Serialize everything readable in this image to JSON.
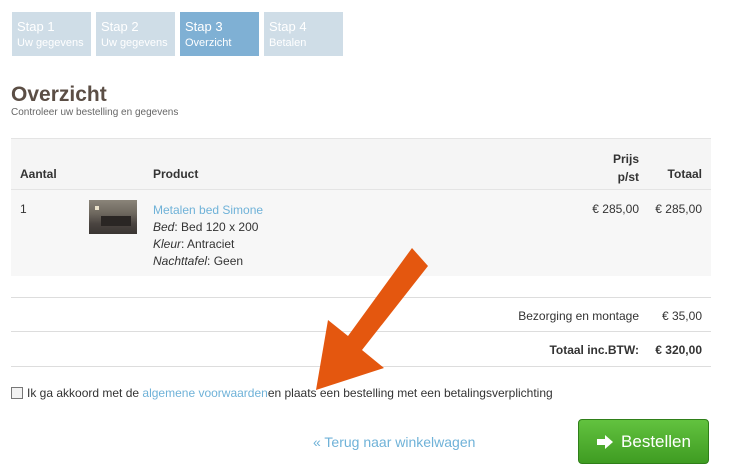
{
  "steps": [
    {
      "num": "Stap 1",
      "label": "Uw gegevens"
    },
    {
      "num": "Stap 2",
      "label": "Uw gegevens"
    },
    {
      "num": "Stap 3",
      "label": "Overzicht"
    },
    {
      "num": "Stap 4",
      "label": "Betalen"
    }
  ],
  "page": {
    "title": "Overzicht",
    "subtitle": "Controleer uw bestelling en gegevens"
  },
  "table": {
    "headers": {
      "aantal": "Aantal",
      "product": "Product",
      "prijs_line1": "Prijs",
      "prijs_line2": "p/st",
      "totaal": "Totaal"
    },
    "rows": [
      {
        "qty": "1",
        "name": "Metalen bed Simone",
        "bed_label": "Bed",
        "bed_value": ": Bed 120 x 200",
        "kleur_label": "Kleur",
        "kleur_value": ": Antraciet",
        "nachttafel_label": "Nachttafel",
        "nachttafel_value": ": Geen",
        "price": "€ 285,00",
        "total": "€ 285,00"
      }
    ]
  },
  "summary": {
    "delivery_label": "Bezorging en montage",
    "delivery_value": "€ 35,00",
    "total_label": "Totaal inc.BTW:",
    "total_value": "€ 320,00"
  },
  "agreement": {
    "before": "Ik ga akkoord met de ",
    "link": "algemene voorwaarden",
    "after": " en plaats een bestelling met een betalingsverplichting"
  },
  "actions": {
    "back_label": "« Terug naar winkelwagen",
    "order_label": "Bestellen"
  },
  "colors": {
    "link": "#6fb2d8",
    "step_active": "#7fb0d4",
    "step_inactive": "#cfdde7",
    "order_button": "#4caf2c",
    "annotation_arrow": "#e4570f"
  }
}
